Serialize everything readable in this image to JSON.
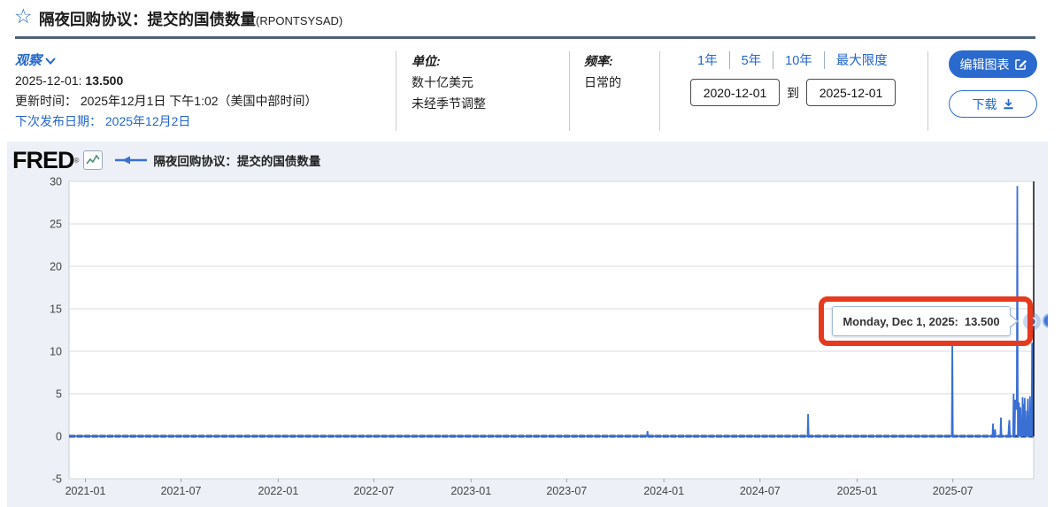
{
  "header": {
    "title": "隔夜回购协议：提交的国债数量",
    "series_id": "(RPONTSYSAD)",
    "star_icon": "☆"
  },
  "observation": {
    "label": "观察",
    "date": "2025-12-01:",
    "value": "13.500",
    "updated_label": "更新时间：",
    "updated": "2025年12月1日 下午1:02（美国中部时间）",
    "next_release_label": "下次发布日期：",
    "next_release": "2025年12月2日"
  },
  "units": {
    "label": "单位:",
    "line1": "数十亿美元",
    "line2": "未经季节调整"
  },
  "frequency": {
    "label": "频率:",
    "value": "日常的"
  },
  "range": {
    "links": [
      "1年",
      "5年",
      "10年",
      "最大限度"
    ],
    "from": "2020-12-01",
    "to_label": "到",
    "to": "2025-12-01"
  },
  "actions": {
    "edit": "编辑图表",
    "download": "下载"
  },
  "chart": {
    "logo": "FRED",
    "legend": "隔夜回购协议：提交的国债数量",
    "tooltip_date": "Monday, Dec 1, 2025:",
    "tooltip_value": "13.500"
  },
  "colors": {
    "accent": "#2366cc",
    "spike_line": "#3a6fd4",
    "baseline_line": "#1e3f80",
    "highlight_red": "#e63a1f",
    "chart_bg": "#edf1f7",
    "grid": "#d5d9de"
  },
  "chart_data": {
    "type": "line",
    "series_name": "隔夜回购协议：提交的国债数量",
    "x_start": "2020-12-01",
    "x_end": "2025-12-01",
    "ylim": [
      -5,
      30
    ],
    "yticks": [
      -5,
      0,
      5,
      10,
      15,
      20,
      25,
      30
    ],
    "xticks": [
      {
        "label": "2021-01",
        "date": "2021-01-01"
      },
      {
        "label": "2021-07",
        "date": "2021-07-01"
      },
      {
        "label": "2022-01",
        "date": "2022-01-01"
      },
      {
        "label": "2022-07",
        "date": "2022-07-01"
      },
      {
        "label": "2023-01",
        "date": "2023-01-01"
      },
      {
        "label": "2023-07",
        "date": "2023-07-01"
      },
      {
        "label": "2024-01",
        "date": "2024-01-01"
      },
      {
        "label": "2024-07",
        "date": "2024-07-01"
      },
      {
        "label": "2025-01",
        "date": "2025-01-01"
      },
      {
        "label": "2025-07",
        "date": "2025-07-01"
      }
    ],
    "baseline_value": 0,
    "grid": "horizontal",
    "legend_position": "top-left",
    "points": [
      [
        "2023-12-01",
        0.6
      ],
      [
        "2024-09-30",
        2.6
      ],
      [
        "2025-06-30",
        10.9
      ],
      [
        "2025-09-15",
        1.5
      ],
      [
        "2025-09-19",
        0.8
      ],
      [
        "2025-09-30",
        2.2
      ],
      [
        "2025-10-15",
        1.2
      ],
      [
        "2025-10-16",
        1.9
      ],
      [
        "2025-10-24",
        5.0
      ],
      [
        "2025-10-27",
        4.2
      ],
      [
        "2025-10-28",
        4.2
      ],
      [
        "2025-10-29",
        3.1
      ],
      [
        "2025-10-30",
        3.9
      ],
      [
        "2025-10-31",
        29.45
      ],
      [
        "2025-11-03",
        4.0
      ],
      [
        "2025-11-04",
        2.9
      ],
      [
        "2025-11-06",
        3.4
      ],
      [
        "2025-11-10",
        4.6
      ],
      [
        "2025-11-12",
        3.8
      ],
      [
        "2025-11-14",
        4.5
      ],
      [
        "2025-11-18",
        3.0
      ],
      [
        "2025-11-20",
        4.4
      ],
      [
        "2025-11-24",
        4.7
      ],
      [
        "2025-11-26",
        3.2
      ],
      [
        "2025-11-28",
        11.0
      ],
      [
        "2025-12-01",
        13.5
      ]
    ],
    "last_point": {
      "date": "2025-12-01",
      "value": 13.5
    }
  }
}
